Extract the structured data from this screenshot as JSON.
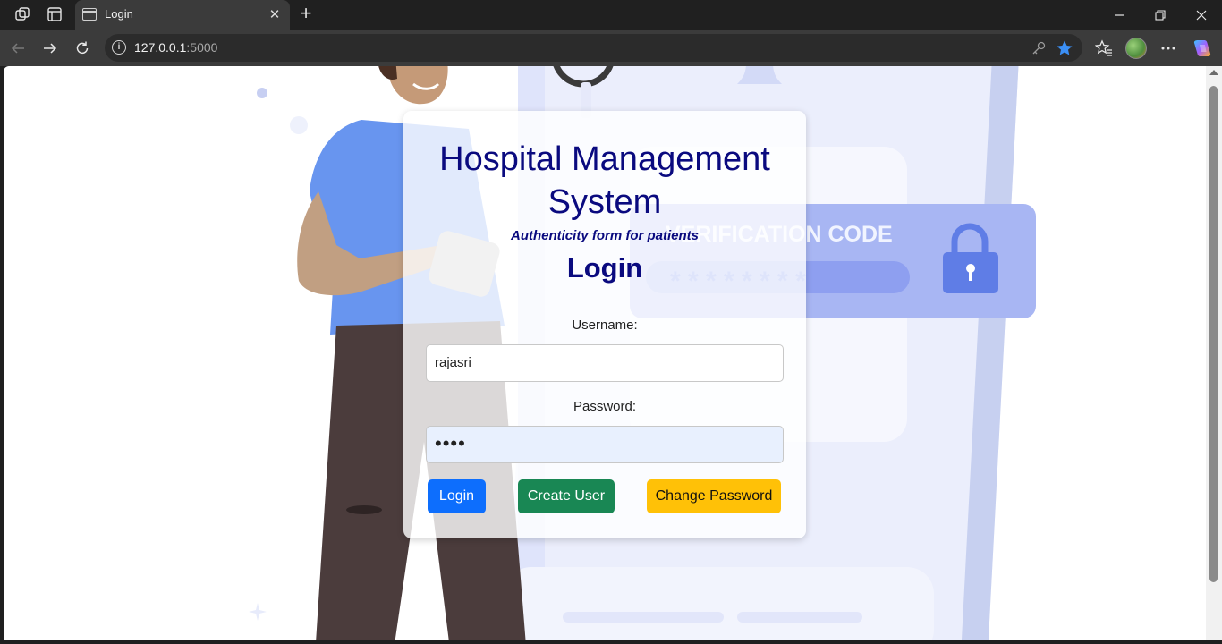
{
  "browser": {
    "tab_title": "Login",
    "address_host": "127.0.0.1",
    "address_port": ":5000"
  },
  "page": {
    "title": "Hospital Management System",
    "subtitle": "Authenticity form for patients",
    "heading": "Login",
    "background_text": "VERIFICATION CODE",
    "username_label": "Username:",
    "username_value": "rajasri",
    "password_label": "Password:",
    "password_value": "••••",
    "buttons": {
      "login": "Login",
      "create_user": "Create User",
      "change_password": "Change Password"
    }
  },
  "colors": {
    "heading": "#0a0a7f",
    "login_button": "#0d6efd",
    "create_button": "#198754",
    "change_button": "#ffc107"
  }
}
